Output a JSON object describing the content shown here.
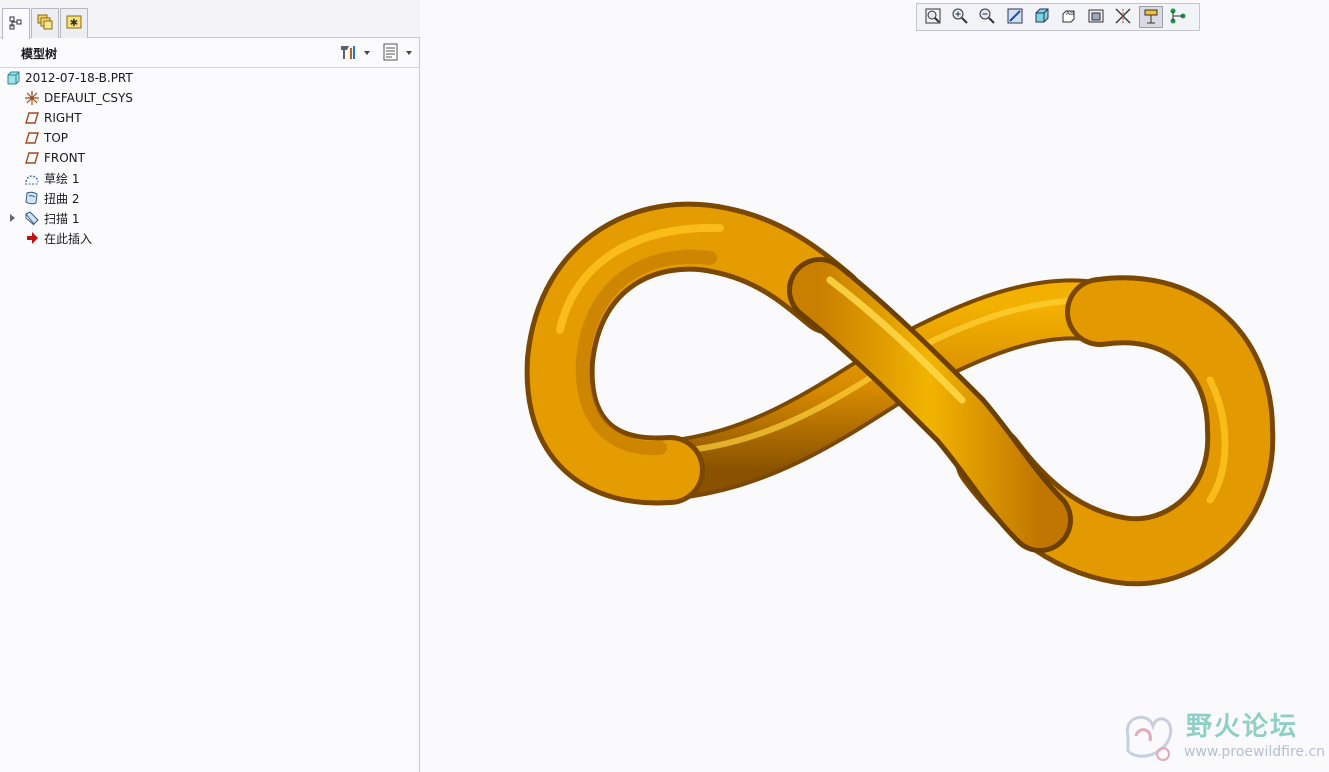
{
  "left_panel": {
    "tabs": [
      {
        "name": "model-tree-tab",
        "icon": "model-tree-icon"
      },
      {
        "name": "layers-tab",
        "icon": "layers-icon"
      },
      {
        "name": "favorites-tab",
        "icon": "favorites-icon"
      }
    ],
    "header": {
      "title": "模型树",
      "settings_icon": "tree-settings-icon",
      "filter_icon": "tree-filter-icon"
    },
    "tree": [
      {
        "label": "2012-07-18-B.PRT",
        "icon": "part-icon"
      },
      {
        "label": "DEFAULT_CSYS",
        "icon": "csys-icon"
      },
      {
        "label": "RIGHT",
        "icon": "datum-plane-icon"
      },
      {
        "label": "TOP",
        "icon": "datum-plane-icon"
      },
      {
        "label": "FRONT",
        "icon": "datum-plane-icon"
      },
      {
        "label": "草绘 1",
        "icon": "sketch-icon"
      },
      {
        "label": "扭曲 2",
        "icon": "warp-icon"
      },
      {
        "label": "扫描 1",
        "icon": "sweep-icon"
      },
      {
        "label": "在此插入",
        "icon": "insert-here-icon"
      }
    ]
  },
  "view_toolbar": [
    "refit-icon",
    "zoom-in-icon",
    "zoom-out-icon",
    "repaint-icon",
    "display-style-icon",
    "saved-orientations-icon",
    "view-manager-icon",
    "datum-display-icon",
    "spin-center-icon",
    "annotation-display-icon"
  ],
  "model": {
    "color": "#e09a00",
    "shape": "infinity-sweep"
  },
  "watermark": {
    "name": "野火论坛",
    "url": "www.proewildfire.cn"
  }
}
